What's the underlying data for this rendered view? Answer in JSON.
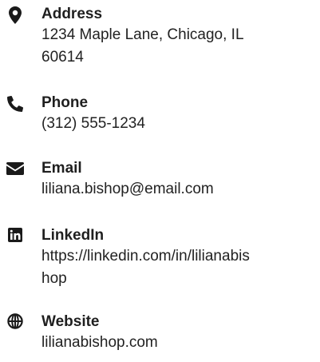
{
  "contacts": [
    {
      "label": "Address",
      "icon": "map-marker-icon",
      "lines": [
        "1234 Maple Lane, Chicago, IL",
        "60614"
      ]
    },
    {
      "label": "Phone",
      "icon": "phone-icon",
      "lines": [
        "(312) 555-1234"
      ]
    },
    {
      "label": "Email",
      "icon": "envelope-icon",
      "lines": [
        "liliana.bishop@email.com"
      ]
    },
    {
      "label": "LinkedIn",
      "icon": "linkedin-icon",
      "lines": [
        "https://linkedin.com/in/lilianabis",
        "hop"
      ]
    },
    {
      "label": "Website",
      "icon": "globe-icon",
      "lines": [
        "lilianabishop.com"
      ]
    }
  ],
  "colors": {
    "icon": "#1a1a1a",
    "label": "#1f1f1f",
    "text": "#222222",
    "background": "#ffffff"
  }
}
